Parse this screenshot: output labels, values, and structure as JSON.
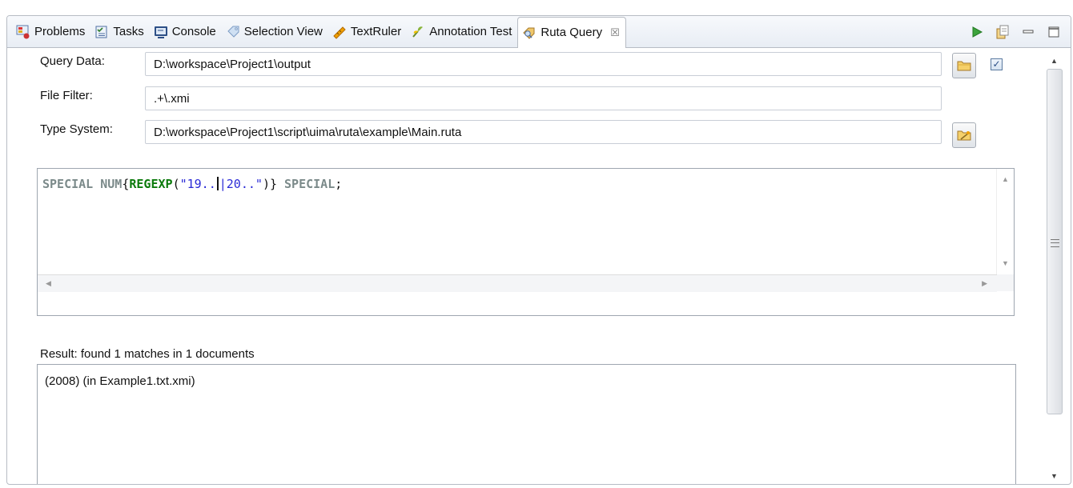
{
  "tabs": [
    {
      "label": "Problems",
      "icon": "problems-icon"
    },
    {
      "label": "Tasks",
      "icon": "tasks-icon"
    },
    {
      "label": "Console",
      "icon": "console-icon"
    },
    {
      "label": "Selection View",
      "icon": "selection-view-icon"
    },
    {
      "label": "TextRuler",
      "icon": "textruler-icon"
    },
    {
      "label": "Annotation Test",
      "icon": "annotation-test-icon"
    },
    {
      "label": "Ruta Query",
      "icon": "ruta-query-icon",
      "active": true,
      "close": "☒"
    }
  ],
  "form": {
    "query_data_label": "Query Data:",
    "query_data_value": "D:\\workspace\\Project1\\output",
    "file_filter_label": "File Filter:",
    "file_filter_value": ".+\\.xmi",
    "type_system_label": "Type System:",
    "type_system_value": "D:\\workspace\\Project1\\script\\uima\\ruta\\example\\Main.ruta",
    "recursive_checked": true,
    "checkbox_mark": "✓"
  },
  "editor": {
    "tokens": {
      "t1": "SPECIAL NUM",
      "t2": "{",
      "t3": "REGEXP",
      "t4": "(",
      "t5": "\"19..",
      "t6": "|20..\"",
      "t7": ")}",
      "t8": " SPECIAL",
      "t9": ";"
    },
    "scroll_up": "▲",
    "scroll_down": "▼",
    "scroll_left": "◀",
    "scroll_right": "▶"
  },
  "result": {
    "label": "Result: found 1 matches in 1 documents",
    "items": [
      "(2008) (in Example1.txt.xmi)"
    ]
  },
  "scrollbar": {
    "up": "▲",
    "down": "▼"
  },
  "colors": {
    "keyword": "#7b8a8a",
    "function": "#0b7a0b",
    "string": "#2a2ad6",
    "border": "#b7bcc4"
  }
}
